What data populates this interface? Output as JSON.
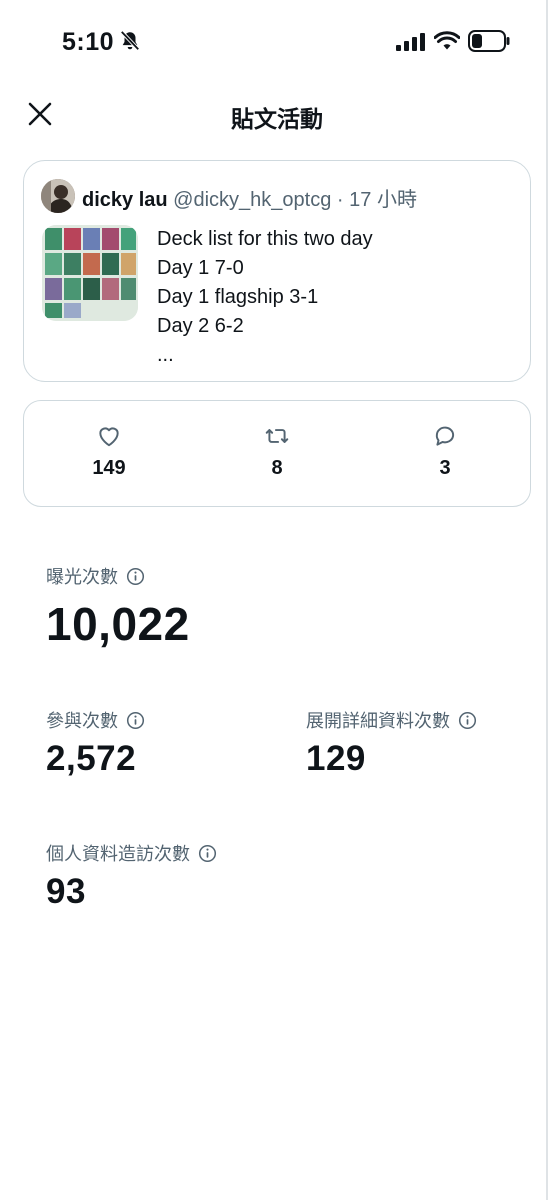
{
  "status_bar": {
    "time": "5:10"
  },
  "header": {
    "title": "貼文活動"
  },
  "post": {
    "author_name": "dicky lau",
    "author_handle": "@dicky_hk_optcg",
    "separator": "·",
    "time_ago": "17 小時",
    "text_lines": [
      "Deck list for this two day",
      "Day 1 7-0",
      "Day 1 flagship 3-1",
      "Day 2 6-2",
      "..."
    ]
  },
  "engagement": {
    "likes": "149",
    "reposts": "8",
    "replies": "3"
  },
  "metrics": {
    "impressions": {
      "label": "曝光次數",
      "value": "10,022"
    },
    "engagements": {
      "label": "參與次數",
      "value": "2,572"
    },
    "detail_expands": {
      "label": "展開詳細資料次數",
      "value": "129"
    },
    "profile_visits": {
      "label": "個人資料造訪次數",
      "value": "93"
    }
  },
  "icons": {
    "close": "close-icon",
    "like": "heart-icon",
    "repost": "repost-icon",
    "reply": "reply-icon",
    "info": "info-icon"
  },
  "colors": {
    "text": "#0f1419",
    "secondary": "#536471",
    "border": "#cfd9de"
  }
}
